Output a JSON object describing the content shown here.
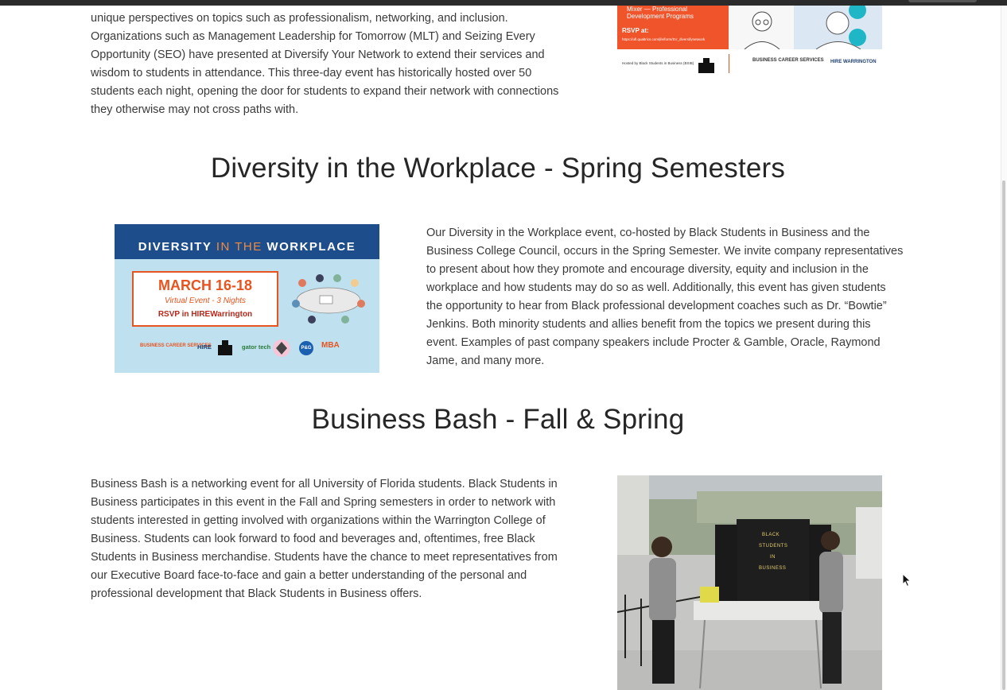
{
  "sections": {
    "intro": {
      "paragraph": "unique perspectives on topics such as professionalism, networking, and inclusion. Organizations such as Management Leadership for Tomorrow (MLT) and Seizing Every Opportunity (SEO) have presented at Diversify Your Network to extend their services and wisdom to students in attendance. This three-day event has historically hosted over 50 students each night, opening the door for students to expand their network with connections they otherwise may not cross paths with."
    },
    "diversity": {
      "heading": "Diversity in the Workplace - Spring Semesters",
      "paragraph": "Our Diversity in the Workplace event, co-hosted by Black Students in Business and the Business College Council, occurs in the Spring Semester. We invite company representatives to present about how they promote and encourage diversity, equity and inclusion in the workplace and how students may do so as well. Additionally, this event has given students the opportunity to hear from Black professional development coaches such as Dr. “Bowtie” Jenkins. Both minority students and allies benefit from the topics we present during this event. Examples of past company speakers include Procter & Gamble, Oracle, Raymond Jame, and many more."
    },
    "business_bash": {
      "heading": "Business Bash - Fall & Spring",
      "paragraph": "Business Bash is a networking event for all University of Florida students. Black Students in Business participates in this event in the Fall and Spring semesters in order to network with students interested in getting involved with organizations within the Warrington College of Business. Students can look forward to food and beverages and, oftentimes, free Black Students in Business merchandise. Students have the chance to meet representatives from our Executive Board face-to-face and gain a better understanding of the personal and professional development that Black Students in Business offers."
    }
  },
  "flyer_top": {
    "line1": "Mixer — Professional",
    "line2": "Development Programs",
    "rsvp": "RSVP at:",
    "link": "https://ufl.qualtrics.com/jfe/form/SV_diversifynetwork",
    "host": "Hosted by Black Students in Business (BSIB)",
    "bcs": "BUSINESS CAREER SERVICES",
    "hire": "HIRE WARRINGTON"
  },
  "diversity_image": {
    "banner_word1": "DIVERSITY",
    "banner_word2": "IN THE",
    "banner_word3": "WORKPLACE",
    "dates": "MARCH 16-18",
    "subtitle": "Virtual Event - 3 Nights",
    "rsvp": "RSVP in HIREWarrington",
    "logo_bcs": "BUSINESS CAREER SERVICES",
    "logo_hire": "HIRE",
    "logo_gator": "gator tech",
    "logo_pg": "P&G",
    "logo_mba": "MBA"
  },
  "photo": {
    "sign_line1": "BLACK",
    "sign_line2": "STUDENTS",
    "sign_line3": "IN",
    "sign_line4": "BUSINESS"
  },
  "colors": {
    "heading": "#262626",
    "body_text": "#3a3a3a",
    "flyer_orange": "#f0542b",
    "banner_blue": "#1e4d8c",
    "accent_orange": "#e8541f"
  }
}
